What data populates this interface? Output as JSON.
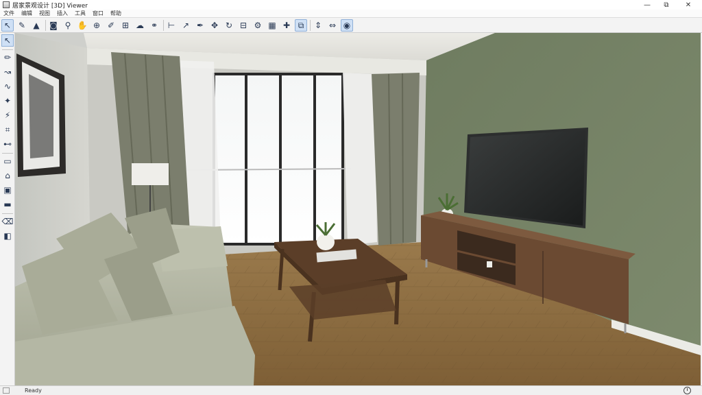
{
  "window": {
    "title": "居家景观设计 [3D] Viewer",
    "minimize_glyph": "—",
    "restore_glyph": "⧉",
    "close_glyph": "✕"
  },
  "menu": {
    "items": [
      "文件",
      "编辑",
      "视图",
      "插入",
      "工具",
      "窗口",
      "帮助"
    ]
  },
  "toolbar": {
    "buttons": [
      {
        "name": "select-arrow-icon",
        "glyph": "↖",
        "active": true
      },
      {
        "name": "paint-icon",
        "glyph": "✎",
        "active": false
      },
      {
        "name": "triangle-icon",
        "glyph": "▲",
        "active": false
      },
      {
        "name": "camera-icon",
        "glyph": "◙",
        "active": false
      },
      {
        "name": "magnifier-icon",
        "glyph": "⚲",
        "active": false
      },
      {
        "name": "hand-icon",
        "glyph": "✋",
        "active": false
      },
      {
        "name": "zoom-icon",
        "glyph": "⊕",
        "active": false
      },
      {
        "name": "pen-icon",
        "glyph": "✐",
        "active": false
      },
      {
        "name": "node-icon",
        "glyph": "⊞",
        "active": false
      },
      {
        "name": "cloud-icon",
        "glyph": "☁",
        "active": false
      },
      {
        "name": "link-icon",
        "glyph": "⚭",
        "active": false
      },
      {
        "name": "measure-icon",
        "glyph": "⊢",
        "active": false
      },
      {
        "name": "line-icon",
        "glyph": "↗",
        "active": false
      },
      {
        "name": "brush-icon",
        "glyph": "✒",
        "active": false
      },
      {
        "name": "move-icon",
        "glyph": "✥",
        "active": false
      },
      {
        "name": "rotate-icon",
        "glyph": "↻",
        "active": false
      },
      {
        "name": "grid-icon",
        "glyph": "⊟",
        "active": false
      },
      {
        "name": "settings-icon",
        "glyph": "⚙",
        "active": false
      },
      {
        "name": "layout-icon",
        "glyph": "▦",
        "active": false
      },
      {
        "name": "snap-icon",
        "glyph": "✚",
        "active": false
      },
      {
        "name": "group-icon",
        "glyph": "⧉",
        "active": true
      },
      {
        "name": "vertical-move-icon",
        "glyph": "⇕",
        "active": false
      },
      {
        "name": "align-icon",
        "glyph": "⇔",
        "active": false
      },
      {
        "name": "render-icon",
        "glyph": "◉",
        "active": true
      }
    ]
  },
  "lefttools": {
    "buttons": [
      {
        "name": "pointer-tool-icon",
        "glyph": "↖",
        "active": true
      },
      {
        "name": "pencil-tool-icon",
        "glyph": "✏"
      },
      {
        "name": "path-tool-icon",
        "glyph": "↝"
      },
      {
        "name": "curve-tool-icon",
        "glyph": "∿"
      },
      {
        "name": "star-tool-icon",
        "glyph": "✦"
      },
      {
        "name": "wand-tool-icon",
        "glyph": "⚡"
      },
      {
        "name": "crop-tool-icon",
        "glyph": "⌗"
      },
      {
        "name": "node-tool-icon",
        "glyph": "⊷"
      },
      {
        "name": "wall-tool-icon",
        "glyph": "▭"
      },
      {
        "name": "room-tool-icon",
        "glyph": "⌂"
      },
      {
        "name": "picture-tool-icon",
        "glyph": "▣"
      },
      {
        "name": "monitor-tool-icon",
        "glyph": "▬"
      },
      {
        "name": "eraser-tool-icon",
        "glyph": "⌫"
      },
      {
        "name": "bucket-tool-icon",
        "glyph": "◧"
      }
    ]
  },
  "status": {
    "text": "Ready"
  },
  "colors": {
    "accent_wall": "#727f63",
    "floor": "#8a6a3e",
    "sofa": "#b9bca9",
    "wood": "#6b4a32"
  }
}
